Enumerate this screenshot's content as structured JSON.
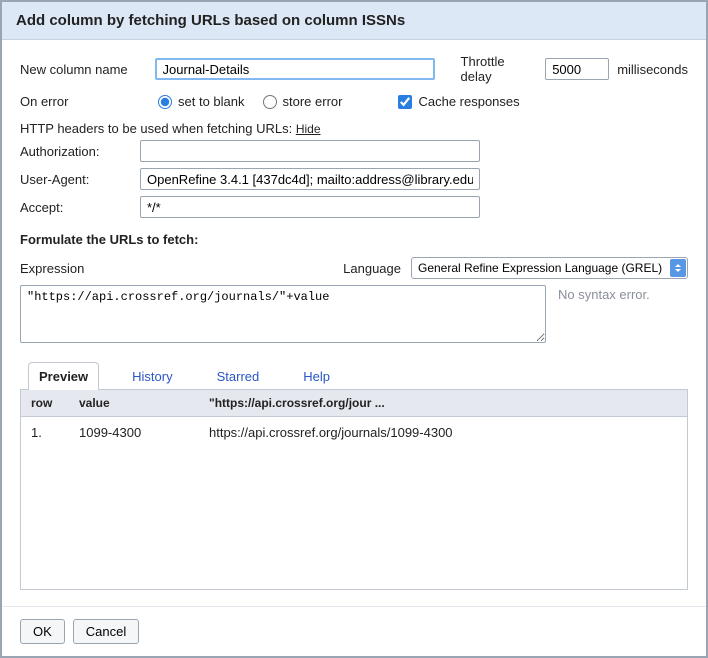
{
  "title": "Add column by fetching URLs based on column ISSNs",
  "newColumn": {
    "label": "New column name",
    "value": "Journal-Details"
  },
  "throttle": {
    "label": "Throttle delay",
    "value": "5000",
    "unit": "milliseconds"
  },
  "onError": {
    "label": "On error",
    "options": {
      "setBlank": "set to blank",
      "storeError": "store error"
    },
    "selected": "setBlank"
  },
  "cache": {
    "label": "Cache responses",
    "checked": true
  },
  "headers": {
    "title": "HTTP headers to be used when fetching URLs:",
    "toggle": "Hide",
    "rows": [
      {
        "key": "Authorization:",
        "value": ""
      },
      {
        "key": "User-Agent:",
        "value": "OpenRefine 3.4.1 [437dc4d]; mailto:address@library.edu"
      },
      {
        "key": "Accept:",
        "value": "*/*"
      }
    ]
  },
  "formulate": {
    "title": "Formulate the URLs to fetch:"
  },
  "expression": {
    "label": "Expression",
    "langLabel": "Language",
    "langValue": "General Refine Expression Language (GREL)",
    "value": "\"https://api.crossref.org/journals/\"+value",
    "status": "No syntax error."
  },
  "tabs": {
    "preview": "Preview",
    "history": "History",
    "starred": "Starred",
    "help": "Help",
    "active": "preview"
  },
  "preview": {
    "cols": {
      "row": "row",
      "value": "value",
      "result": "\"https://api.crossref.org/jour ..."
    },
    "rows": [
      {
        "n": "1.",
        "value": "1099-4300",
        "result": "https://api.crossref.org/journals/1099-4300"
      }
    ]
  },
  "buttons": {
    "ok": "OK",
    "cancel": "Cancel"
  }
}
